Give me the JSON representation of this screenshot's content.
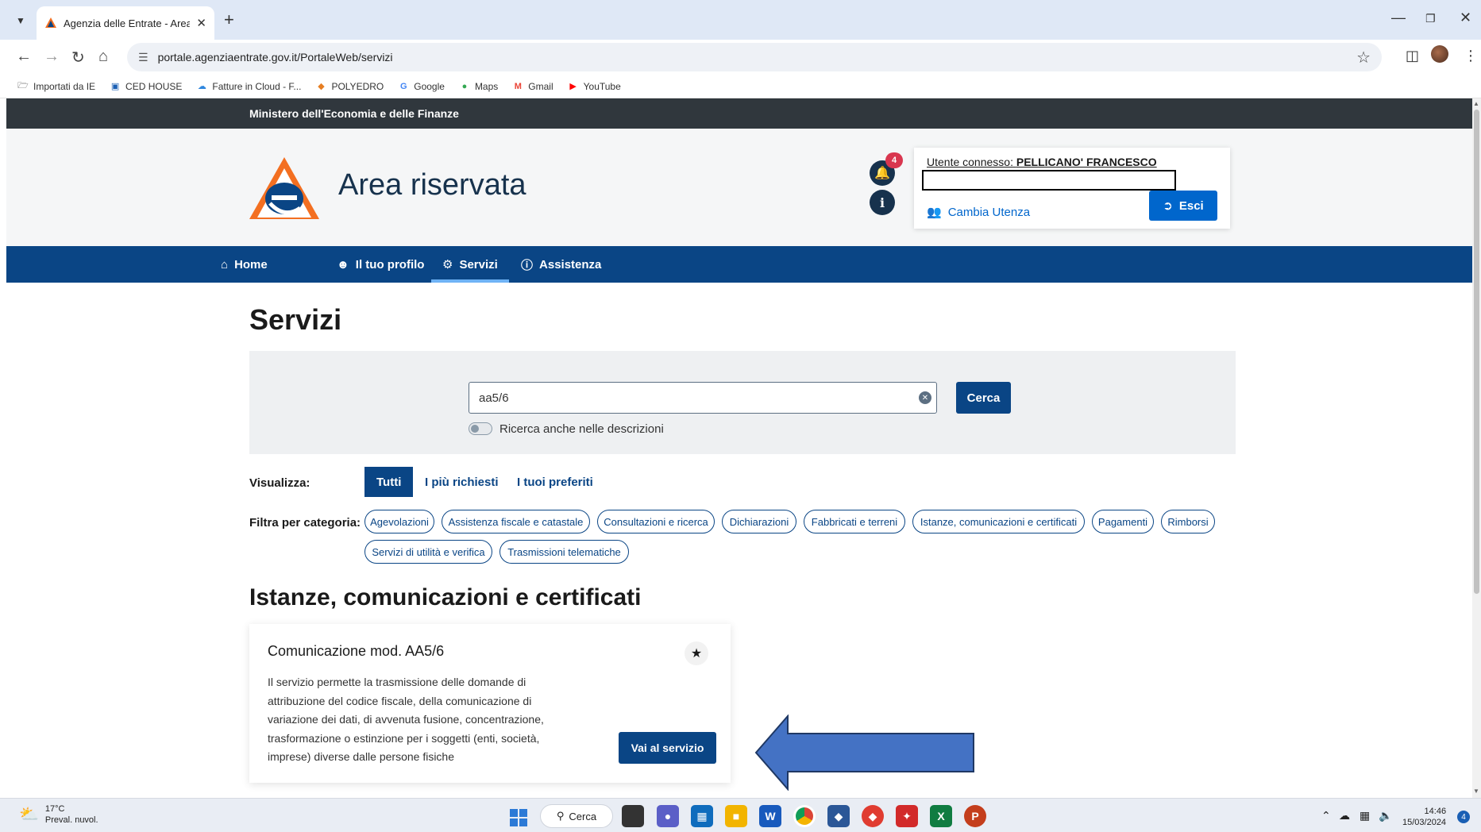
{
  "browser": {
    "tab_title": "Agenzia delle Entrate - Area ris",
    "url": "portale.agenziaentrate.gov.it/PortaleWeb/servizi",
    "bookmarks": [
      {
        "label": "Importati da IE",
        "icon": "folder-icon"
      },
      {
        "label": "CED HOUSE",
        "icon": "building-icon"
      },
      {
        "label": "Fatture in Cloud - F...",
        "icon": "cloud-icon"
      },
      {
        "label": "POLYEDRO",
        "icon": "polyedro-icon"
      },
      {
        "label": "Google",
        "icon": "google-icon"
      },
      {
        "label": "Maps",
        "icon": "maps-pin-icon"
      },
      {
        "label": "Gmail",
        "icon": "gmail-icon"
      },
      {
        "label": "YouTube",
        "icon": "youtube-icon"
      }
    ]
  },
  "site": {
    "ministry": "Ministero dell'Economia e delle Finanze",
    "area_title": "Area riservata",
    "notification_count": "4",
    "user_label": "Utente connesso:",
    "user_name": "PELLICANO' FRANCESCO",
    "cambia_utenza": "Cambia Utenza",
    "esci": "Esci",
    "nav": [
      "Home",
      "Il tuo profilo",
      "Servizi",
      "Assistenza"
    ],
    "colors": {
      "accent": "#0a4585",
      "topbar": "#30373d",
      "link": "#0066cc",
      "badge": "#d9364f"
    }
  },
  "servizi": {
    "title": "Servizi",
    "search_value": "aa5/6",
    "search_button": "Cerca",
    "toggle_label": "Ricerca anche nelle descrizioni",
    "visualizza_label": "Visualizza:",
    "view_tabs": [
      "Tutti",
      "I più richiesti",
      "I tuoi preferiti"
    ],
    "filtra_label": "Filtra per categoria:",
    "categories": [
      "Agevolazioni",
      "Assistenza fiscale e catastale",
      "Consultazioni e ricerca",
      "Dichiarazioni",
      "Fabbricati e terreni",
      "Istanze, comunicazioni e certificati",
      "Pagamenti",
      "Rimborsi",
      "Servizi di utilità e verifica",
      "Trasmissioni telematiche"
    ],
    "section_title": "Istanze, comunicazioni e certificati",
    "card": {
      "title": "Comunicazione mod. AA5/6",
      "description": "Il servizio permette la trasmissione delle domande di attribuzione del codice fiscale, della comunicazione di variazione dei dati, di avvenuta fusione, concentrazione, trasformazione o estinzione per i soggetti (enti, società, imprese) diverse dalle persone fisiche",
      "button": "Vai al servizio"
    }
  },
  "taskbar": {
    "temp": "17°C",
    "weather": "Preval. nuvol.",
    "search": "Cerca",
    "time": "14:46",
    "date": "15/03/2024",
    "notif": "4"
  }
}
